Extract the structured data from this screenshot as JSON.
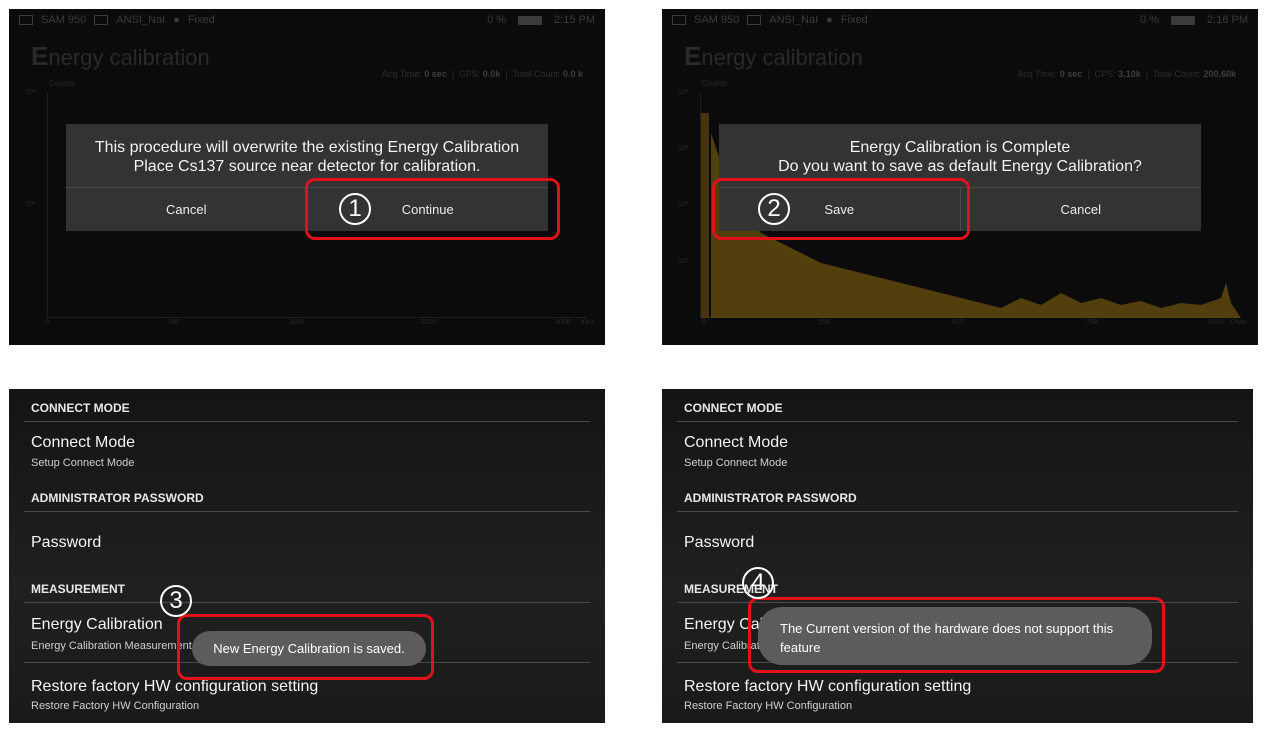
{
  "status_bar": {
    "device": "SAM 950",
    "detector": "ANSI_NaI",
    "mode": "Fixed",
    "battery": "0 %",
    "time_1": "2:15 PM",
    "time_2": "2:16 PM"
  },
  "calibration_screen": {
    "title": "Energy calibration",
    "counts_label": "Counts",
    "before": {
      "acq_label": "Acq Time:",
      "acq_value": "0 sec",
      "cps_label": "CPS:",
      "cps_value": "0.0k",
      "total_label": "Total Count:",
      "total_value": "0.0 k",
      "x_ticks": [
        "0",
        "768",
        "1000",
        "2000",
        "3000"
      ],
      "x_unit": "KeV",
      "y_ticks": [
        "10²",
        "10¹"
      ]
    },
    "after": {
      "acq_label": "Acq Time:",
      "acq_value": "0 sec",
      "cps_label": "CPS:",
      "cps_value": "3.10k",
      "total_label": "Total Count:",
      "total_value": "200.60k",
      "x_ticks": [
        "0",
        "256",
        "512",
        "768",
        "1024"
      ],
      "x_unit": "Chan",
      "y_ticks": [
        "10³",
        "10²",
        "10¹",
        "10⁰"
      ]
    }
  },
  "dialog_overwrite": {
    "message_line1": "This procedure will overwrite the existing Energy Calibration",
    "message_line2": "Place Cs137 source near detector for calibration.",
    "cancel_label": "Cancel",
    "continue_label": "Continue"
  },
  "dialog_complete": {
    "message_line1": "Energy Calibration is Complete",
    "message_line2": "Do you want to save as default Energy Calibration?",
    "save_label": "Save",
    "cancel_label": "Cancel"
  },
  "settings": {
    "connect_header": "CONNECT MODE",
    "connect_title": "Connect Mode",
    "connect_sub": "Setup Connect Mode",
    "admin_header": "ADMINISTRATOR PASSWORD",
    "password_title": "Password",
    "measurement_header": "MEASUREMENT",
    "energy_title": "Energy Calibration",
    "energy_sub": "Energy Calibration Measurement",
    "restore_title": "Restore factory HW configuration setting",
    "restore_sub": "Restore Factory HW Configuration"
  },
  "toast_saved": "New Energy Calibration is saved.",
  "toast_unsupported": "The Current version of the hardware does not support this feature",
  "steps": [
    "1",
    "2",
    "3",
    "4"
  ],
  "colors": {
    "highlight": "#e0111b",
    "dialog": "#333333",
    "spectrum": "#8a6a10"
  }
}
